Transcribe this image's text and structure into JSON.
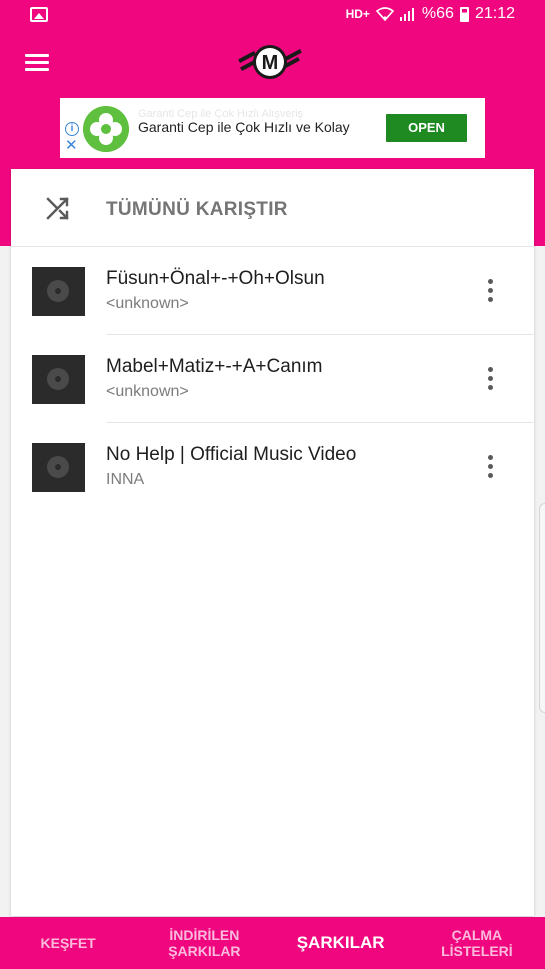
{
  "status_bar": {
    "network": "HD+",
    "battery": "%66",
    "time": "21:12"
  },
  "header": {
    "menu_icon": "hamburger-menu-icon",
    "logo_letter": "M"
  },
  "ad": {
    "ghost_text": "Garanti Cep ile Çok Hızlı Alışveriş",
    "text": "Garanti Cep ile Çok Hızlı ve Kolay",
    "button": "OPEN"
  },
  "shuffle": {
    "icon": "shuffle-icon",
    "label": "TÜMÜNÜ KARIŞTIR"
  },
  "songs": [
    {
      "title": "Füsun+Önal+-+Oh+Olsun",
      "artist": "<unknown>"
    },
    {
      "title": "Mabel+Matiz+-+A+Canım",
      "artist": "<unknown>"
    },
    {
      "title": "No Help | Official Music Video",
      "artist": "INNA"
    }
  ],
  "bottom_nav": {
    "tabs": [
      {
        "label": "KEŞFET"
      },
      {
        "label_line1": "İNDİRİLEN",
        "label_line2": "ŞARKILAR"
      },
      {
        "label": "ŞARKILAR"
      },
      {
        "label_line1": "ÇALMA",
        "label_line2": "LİSTELERİ"
      }
    ],
    "active_index": 2
  },
  "colors": {
    "brand": "#f0077f",
    "ad_button": "#1f8a21"
  }
}
